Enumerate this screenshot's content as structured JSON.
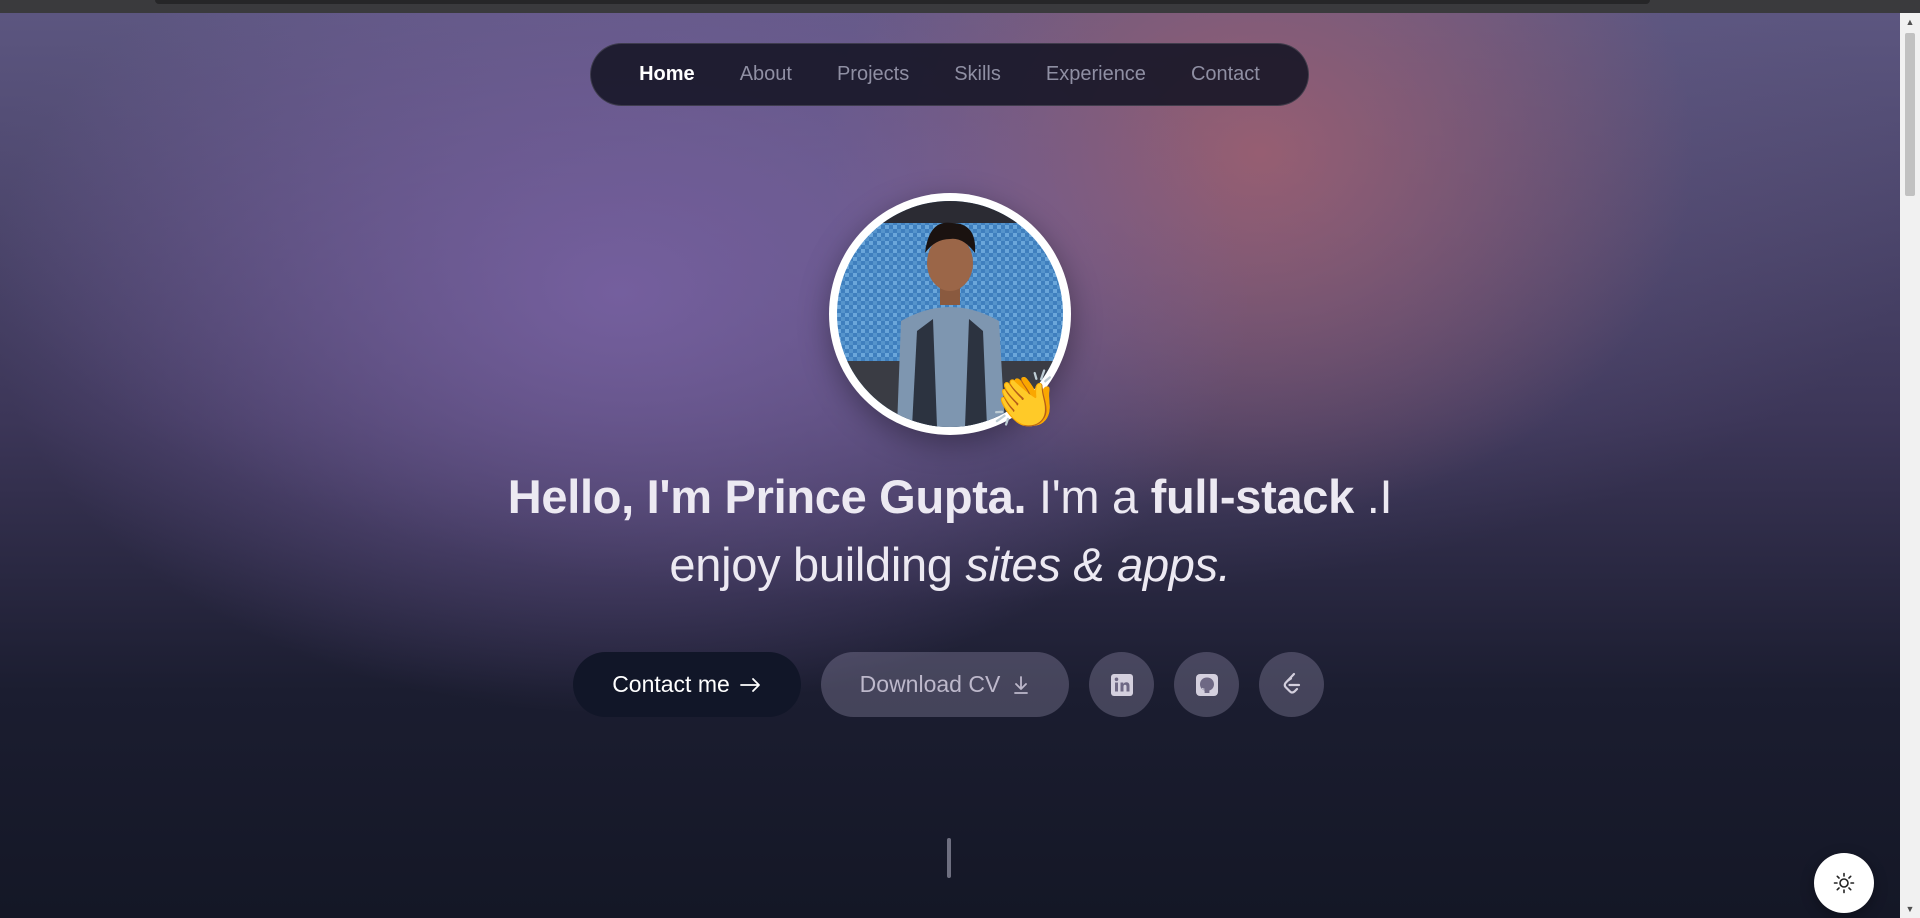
{
  "nav": {
    "items": [
      {
        "label": "Home",
        "active": true
      },
      {
        "label": "About"
      },
      {
        "label": "Projects"
      },
      {
        "label": "Skills"
      },
      {
        "label": "Experience"
      },
      {
        "label": "Contact"
      }
    ]
  },
  "hero": {
    "avatar_icon": "person-photo",
    "wave": "👏",
    "headline": {
      "part1": "Hello, I'm Prince Gupta.",
      "part2": " I'm a ",
      "part3": "full-stack",
      "part4": " .I",
      "part5": "enjoy building ",
      "part6": "sites & apps."
    }
  },
  "actions": {
    "contact_label": "Contact me",
    "contact_icon": "arrow-right-icon",
    "cv_label": "Download CV",
    "cv_icon": "download-icon",
    "social": [
      "linkedin-icon",
      "github-icon",
      "leetcode-icon"
    ]
  },
  "theme_toggle_icon": "sun-icon",
  "colors": {
    "accent": "#111628",
    "nav_active": "#ffffff",
    "nav_inactive": "#8f8fa3"
  }
}
